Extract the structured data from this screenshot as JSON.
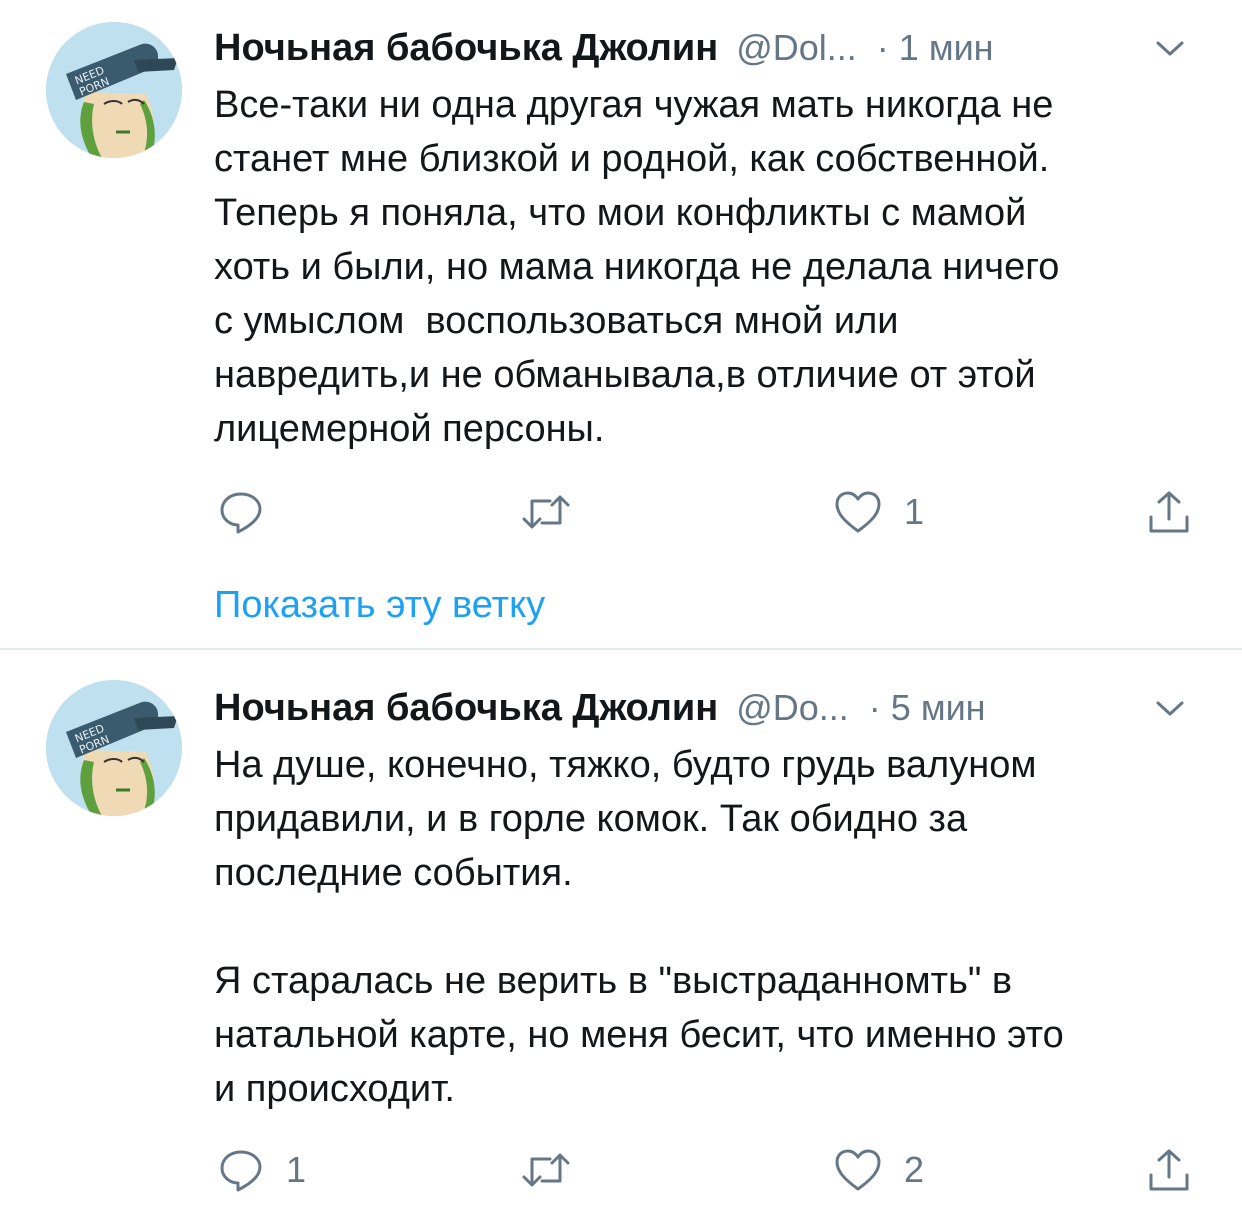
{
  "tweets": [
    {
      "author_name": "Ночьная бабочька Джолин",
      "handle": "@Dol...",
      "separator": "·",
      "time": "1 мин",
      "text": "Все-таки ни одна другая чужая мать никогда не\nстанет мне близкой и родной, как собственной.\nТеперь я поняла, что мои конфликты с мамой\nхоть и были, но мама никогда не делала ничего\nс умыслом  воспользоваться мной или\nнавредить,и не обманывала,в отличие от этой\nлицемерной персоны.",
      "reply_count": "",
      "retweet_count": "",
      "like_count": "1",
      "thread_link": "Показать эту ветку",
      "avatar_cap_text": "NEED PORN"
    },
    {
      "author_name": "Ночьная бабочька Джолин",
      "handle": "@Do...",
      "separator": "·",
      "time": "5 мин",
      "text": "На душе, конечно, тяжко, будто грудь валуном\nпридавили, и в горле комок. Так обидно за\nпоследние события.\n\nЯ старалась не верить в \"выстраданномть\" в\nнатальной карте, но меня бесит, что именно это\nи происходит.",
      "reply_count": "1",
      "retweet_count": "",
      "like_count": "2",
      "avatar_cap_text": "NEED PORN"
    }
  ],
  "icons": {
    "reply": "reply-icon",
    "retweet": "retweet-icon",
    "like": "heart-icon",
    "share": "share-icon",
    "menu": "chevron-down-icon"
  },
  "colors": {
    "text": "#14171a",
    "secondary": "#657786",
    "link": "#1da1f2",
    "divider": "#e6ecf0",
    "avatar_bg": "#bfe0ee"
  }
}
